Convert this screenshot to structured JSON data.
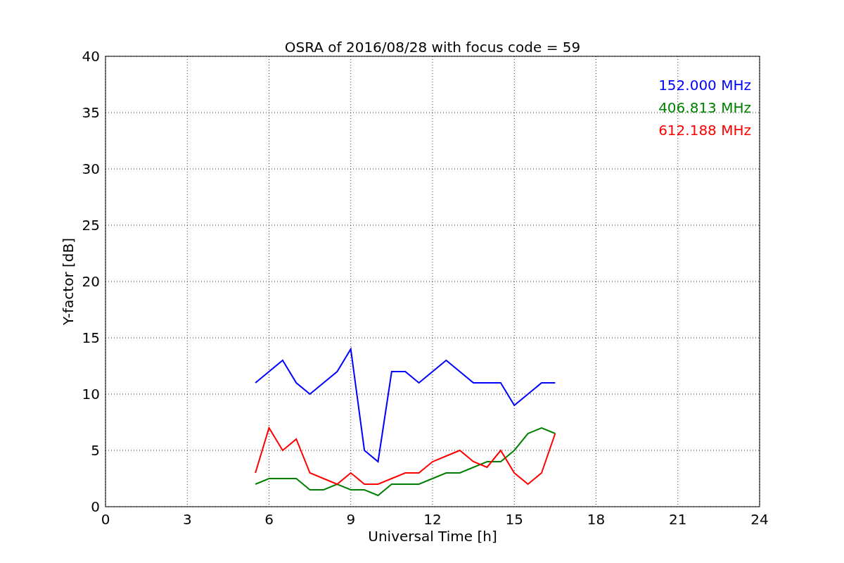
{
  "chart_data": {
    "type": "line",
    "title": "OSRA of 2016/08/28 with focus code = 59",
    "xlabel": "Universal Time [h]",
    "ylabel": "Y-factor [dB]",
    "x": [
      5.5,
      6,
      6.5,
      7,
      7.5,
      8,
      8.5,
      9,
      9.5,
      10,
      10.5,
      11,
      11.5,
      12,
      12.5,
      13,
      13.5,
      14,
      14.5,
      15,
      15.5,
      16,
      16.5
    ],
    "series": [
      {
        "name": "152.000 MHz",
        "color": "#0000ff",
        "values": [
          11,
          12,
          13,
          11,
          10,
          11,
          12,
          14,
          5,
          4,
          12,
          12,
          11,
          12,
          13,
          12,
          11,
          11,
          11,
          9,
          10,
          11,
          11
        ]
      },
      {
        "name": "406.813 MHz",
        "color": "#008000",
        "values": [
          2,
          2.5,
          2.5,
          2.5,
          1.5,
          1.5,
          2,
          1.5,
          1.5,
          1,
          2,
          2,
          2,
          2.5,
          3,
          3,
          3.5,
          4,
          4,
          5,
          6.5,
          7,
          6.5
        ]
      },
      {
        "name": "612.188 MHz",
        "color": "#ff0000",
        "values": [
          3,
          7,
          5,
          6,
          3,
          2.5,
          2,
          3,
          2,
          2,
          2.5,
          3,
          3,
          4,
          4.5,
          5,
          4,
          3.5,
          5,
          3,
          2,
          3,
          6.5
        ]
      }
    ],
    "xlim": [
      0,
      24
    ],
    "ylim": [
      0,
      40
    ],
    "xticks": [
      0,
      3,
      6,
      9,
      12,
      15,
      18,
      21,
      24
    ],
    "yticks": [
      0,
      5,
      10,
      15,
      20,
      25,
      30,
      35,
      40
    ],
    "grid": true
  }
}
